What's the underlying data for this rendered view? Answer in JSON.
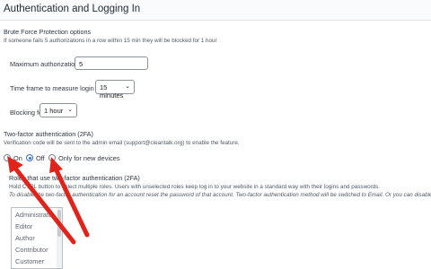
{
  "page": {
    "title": "Authentication and Logging In"
  },
  "brute_force": {
    "heading": "Brute Force Protection options",
    "description": "If someone fails 5 authorizations in a row within 15 min they will be blocked for 1 hour",
    "max_tries_label": "Maximum authorization tries",
    "max_tries_value": "5",
    "timeframe_label": "Time frame to measure login attempts",
    "timeframe_value": "15 minutes",
    "blocking_label": "Blocking for",
    "blocking_value": "1 hour"
  },
  "two_factor": {
    "heading": "Two-factor authentication (2FA)",
    "description": "Verification code will be sent to the admin email (support@cleantalk.org) to enable the feature.",
    "options": [
      {
        "label": "On",
        "checked": false
      },
      {
        "label": "Off",
        "checked": true
      },
      {
        "label": "Only for new devices",
        "checked": false
      }
    ]
  },
  "roles": {
    "heading": "Roles that use two-factor authentication (2FA)",
    "hint": "Hold CTRL button to select multiple roles. Users with unselected roles keep log in to your website in a standard way with their logins and passwords.",
    "note": "To disable the two-factor authentication for an account reset the password of that account. Two-factor authentication method will be switched to Email. Or you can disable it directly on the page of the WordPress site profile.",
    "items": [
      "Administrator",
      "Editor",
      "Author",
      "Contributor",
      "Customer"
    ]
  },
  "colors": {
    "accent": "#2f6fd6",
    "annotation_arrow": "#e0241b"
  },
  "icons": {
    "dropdown": "chevron-down-icon"
  }
}
